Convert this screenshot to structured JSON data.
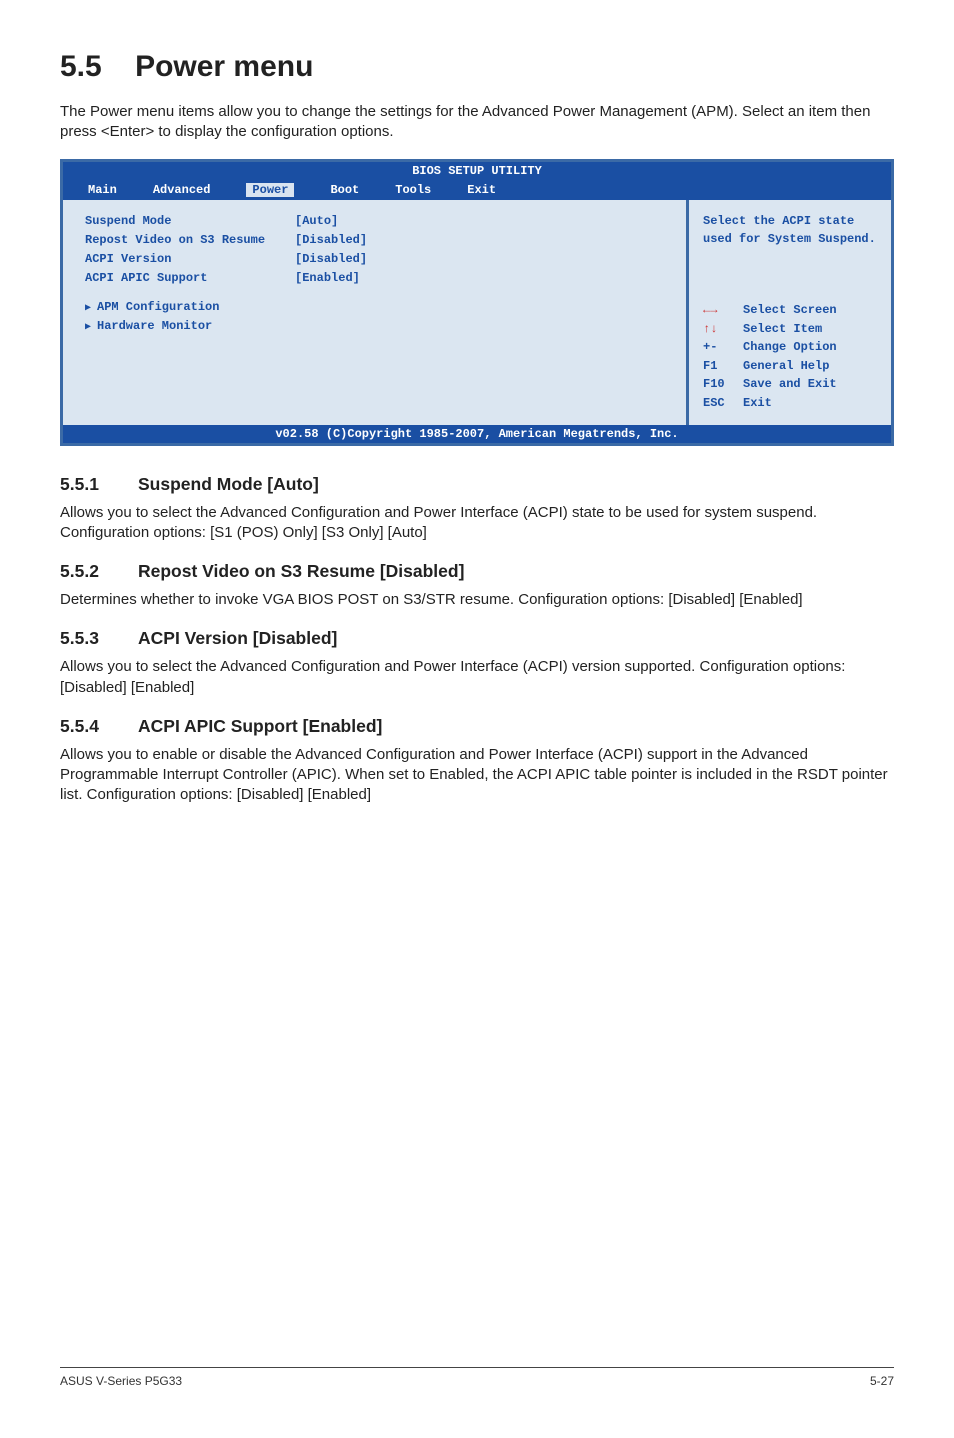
{
  "page": {
    "heading_num": "5.5",
    "heading_title": "Power menu",
    "intro": "The Power menu items allow you to change the settings for the Advanced Power Management (APM). Select an item then press <Enter> to display the configuration options."
  },
  "bios": {
    "title": "BIOS SETUP UTILITY",
    "tabs": [
      "Main",
      "Advanced",
      "Power",
      "Boot",
      "Tools",
      "Exit"
    ],
    "active_tab": "Power",
    "items": [
      {
        "label": "Suspend Mode",
        "value": "[Auto]"
      },
      {
        "label": "Repost Video on S3 Resume",
        "value": "[Disabled]"
      },
      {
        "label": "ACPI Version",
        "value": "[Disabled]"
      },
      {
        "label": "ACPI APIC Support",
        "value": "[Enabled]"
      }
    ],
    "sub_items": [
      "APM Configuration",
      "Hardware Monitor"
    ],
    "help_text": "Select the ACPI state used for System Suspend.",
    "keys": [
      {
        "k": "←→",
        "d": "Select Screen",
        "arrow": true
      },
      {
        "k": "↑↓",
        "d": "Select Item",
        "arrow": true
      },
      {
        "k": "+-",
        "d": "Change Option"
      },
      {
        "k": "F1",
        "d": "General Help"
      },
      {
        "k": "F10",
        "d": "Save and Exit"
      },
      {
        "k": "ESC",
        "d": "Exit"
      }
    ],
    "footer": "v02.58 (C)Copyright 1985-2007, American Megatrends, Inc."
  },
  "sections": [
    {
      "num": "5.5.1",
      "title": "Suspend Mode [Auto]",
      "body": "Allows you to select the Advanced Configuration and Power Interface (ACPI) state to be used for system suspend.\nConfiguration options: [S1 (POS) Only] [S3 Only] [Auto]"
    },
    {
      "num": "5.5.2",
      "title": "Repost Video on S3 Resume [Disabled]",
      "body": "Determines whether to invoke VGA BIOS POST on S3/STR resume. Configuration options: [Disabled] [Enabled]"
    },
    {
      "num": "5.5.3",
      "title": "ACPI Version [Disabled]",
      "body": "Allows you to select the Advanced Configuration and Power Interface (ACPI) version supported. Configuration options: [Disabled] [Enabled]"
    },
    {
      "num": "5.5.4",
      "title": "ACPI APIC Support [Enabled]",
      "body": "Allows you to enable or disable the Advanced Configuration and Power Interface (ACPI) support in the Advanced Programmable Interrupt Controller (APIC). When set to Enabled, the ACPI APIC table pointer is included in the RSDT pointer list. Configuration options: [Disabled] [Enabled]"
    }
  ],
  "footer": {
    "left": "ASUS V-Series P5G33",
    "right": "5-27"
  }
}
